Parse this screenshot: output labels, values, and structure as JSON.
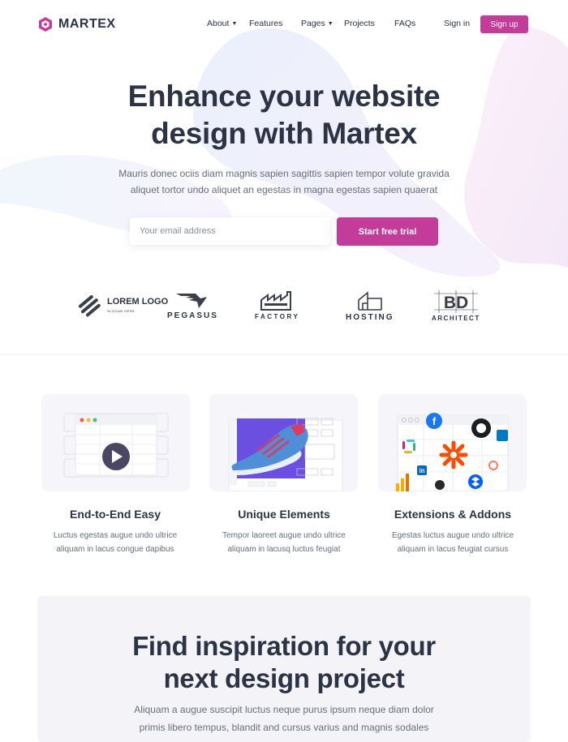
{
  "brand": {
    "name": "MARTEX",
    "accent": "#c43c9a",
    "logo_icon": "martex-cube-icon"
  },
  "nav": {
    "items": [
      {
        "label": "About",
        "dropdown": true
      },
      {
        "label": "Features",
        "dropdown": false
      },
      {
        "label": "Pages",
        "dropdown": true
      },
      {
        "label": "Projects",
        "dropdown": false
      },
      {
        "label": "FAQs",
        "dropdown": false
      }
    ],
    "signin": "Sign in",
    "signup": "Sign up"
  },
  "hero": {
    "title_line1": "Enhance your website",
    "title_line2": "design with Martex",
    "subtitle_line1": "Mauris donec ociis diam magnis sapien sagittis sapien tempor volute gravida",
    "subtitle_line2": "aliquet tortor undo aliquet an egestas in magna egestas sapien quaerat",
    "email_placeholder": "Your email address",
    "cta": "Start free trial"
  },
  "brands": [
    {
      "name": "LOREM LOGO",
      "tagline": "SLOGAN HERE"
    },
    {
      "name": "PEGASUS"
    },
    {
      "name": "FACTORY"
    },
    {
      "name": "HOSTING"
    },
    {
      "name": "ARCHITECT",
      "monogram": "BD"
    }
  ],
  "features": [
    {
      "title": "End-to-End Easy",
      "text_line1": "Luctus egestas augue undo ultrice",
      "text_line2": "aliquam in lacus congue dapibus",
      "icon": "video-play-icon"
    },
    {
      "title": "Unique Elements",
      "text_line1": "Tempor laoreet augue undo ultrice",
      "text_line2": "aliquam in lacusq luctus feugiat",
      "icon": "sneaker-editor-icon"
    },
    {
      "title": "Extensions & Addons",
      "text_line1": "Egestas luctus augue undo ultrice",
      "text_line2": "aliquam in lacus feugiat cursus",
      "icon": "integrations-icon"
    }
  ],
  "inspiration": {
    "title_line1": "Find inspiration for your",
    "title_line2": "next design project",
    "subtitle_line1": "Aliquam a augue suscipit luctus neque purus ipsum neque diam dolor",
    "subtitle_line2": "primis libero tempus, blandit and cursus varius and magnis sodales"
  }
}
